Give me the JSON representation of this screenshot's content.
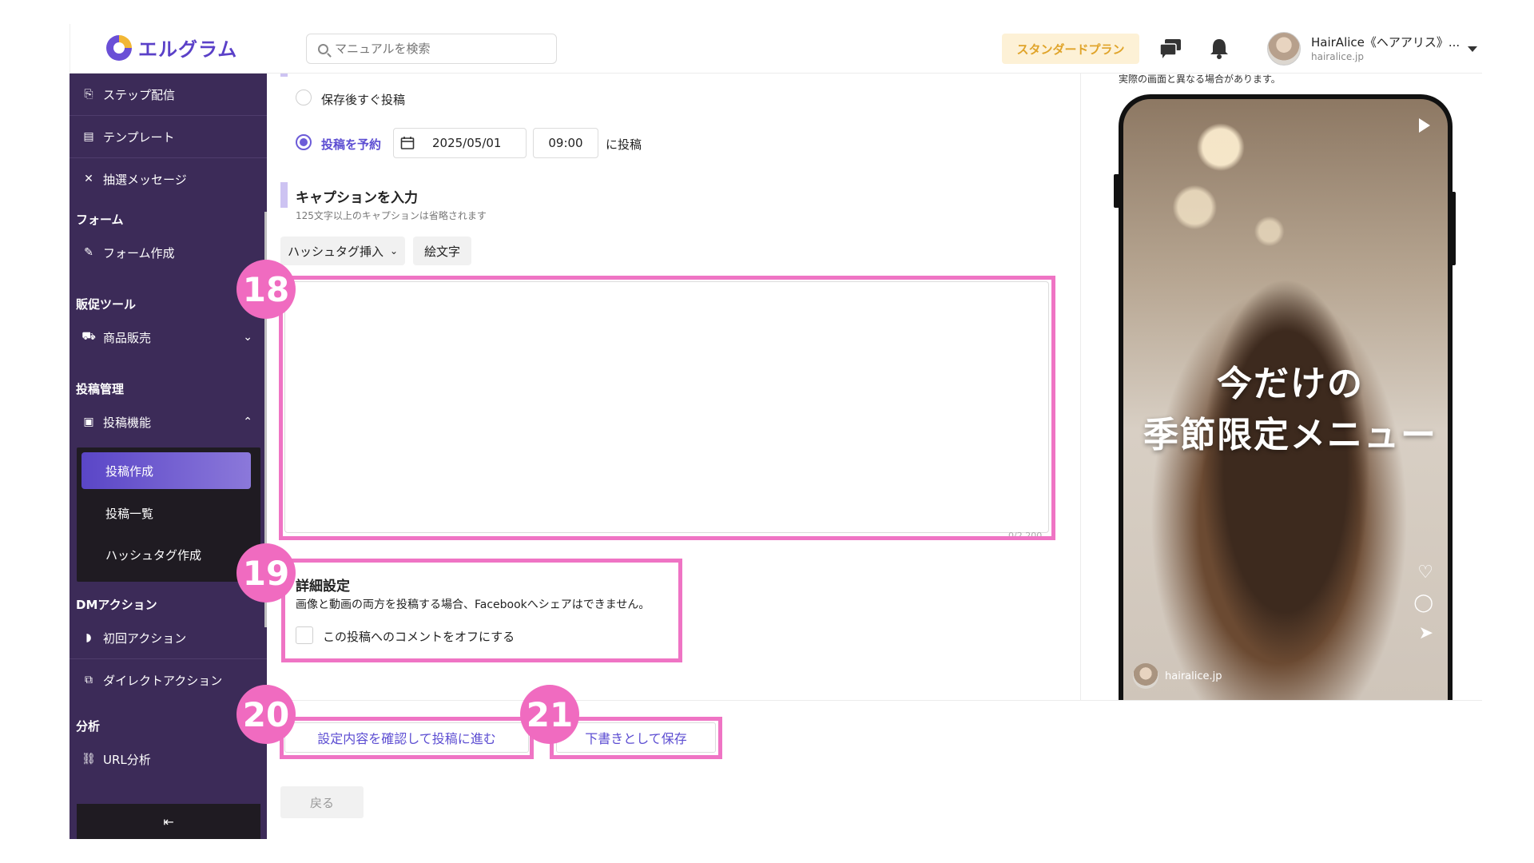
{
  "header": {
    "logo_text": "エルグラム",
    "search_placeholder": "マニュアルを検索",
    "plan_badge": "スタンダードプラン",
    "account_name": "HairAlice《ヘアアリス》...",
    "account_sub": "hairalice.jp"
  },
  "sidebar": {
    "items_top": [
      {
        "label": "ステップ配信",
        "icon": "step-icon"
      },
      {
        "label": "テンプレート",
        "icon": "template-icon"
      },
      {
        "label": "抽選メッセージ",
        "icon": "shuffle-icon"
      }
    ],
    "sections": {
      "form": "フォーム",
      "promo": "販促ツール",
      "post": "投稿管理",
      "dm": "DMアクション",
      "analytics": "分析"
    },
    "form_create": "フォーム作成",
    "product_sales": "商品販売",
    "post_feature": "投稿機能",
    "sub": {
      "post_create": "投稿作成",
      "post_list": "投稿一覧",
      "hashtag_create": "ハッシュタグ作成"
    },
    "first_action": "初回アクション",
    "direct_action": "ダイレクトアクション",
    "url_analysis": "URL分析",
    "collapse_glyph": "⇤"
  },
  "main": {
    "radio_post_after_save": "保存後すぐ投稿",
    "radio_schedule": "投稿を予約",
    "schedule_date": "2025/05/01",
    "schedule_time": "09:00",
    "schedule_suffix": "に投稿",
    "caption_title": "キャプションを入力",
    "caption_note": "125文字以上のキャプションは省略されます",
    "hashtag_btn": "ハッシュタグ挿入",
    "emoji_btn": "絵文字",
    "char_count": "0/2,200",
    "detail_title": "詳細設定",
    "detail_note": "画像と動画の両方を投稿する場合、Facebookへシェアはできません。",
    "comment_off": "この投稿へのコメントをオフにする",
    "confirm_btn": "設定内容を確認して投稿に進む",
    "draft_btn": "下書きとして保存",
    "back_btn": "戻る"
  },
  "callouts": [
    "18",
    "19",
    "20",
    "21"
  ],
  "preview": {
    "note": "実際の画面と異なる場合があります。",
    "line1": "今だけの",
    "line2": "季節限定メニュー",
    "handle": "hairalice.jp"
  },
  "colors": {
    "sidebar": "#3c2b58",
    "accent": "#6c5bd8",
    "highlight": "#ef74c4",
    "plan_bg": "#fdf1d6"
  }
}
